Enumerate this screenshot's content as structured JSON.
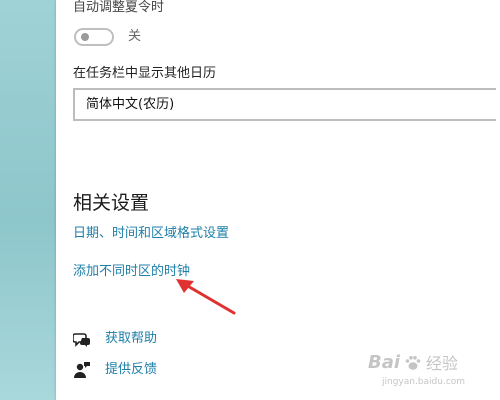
{
  "settings": {
    "dst_label": "自动调整夏令时",
    "dst_toggle_state": "关",
    "dst_toggle_on": false,
    "calendar_label": "在任务栏中显示其他日历",
    "calendar_selected": "简体中文(农历)"
  },
  "related": {
    "title": "相关设置",
    "links": [
      "日期、时间和区域格式设置",
      "添加不同时区的时钟"
    ]
  },
  "support": {
    "help_label": "获取帮助",
    "feedback_label": "提供反馈"
  },
  "watermark": {
    "brand": "Bai",
    "suffix": "经验",
    "url": "jingyan.baidu.com"
  },
  "colors": {
    "link": "#1e7fa8",
    "arrow": "#e03030",
    "desktop": "#9fd2d6"
  },
  "icons": {
    "help": "help-chat-icon",
    "feedback": "feedback-person-icon"
  }
}
